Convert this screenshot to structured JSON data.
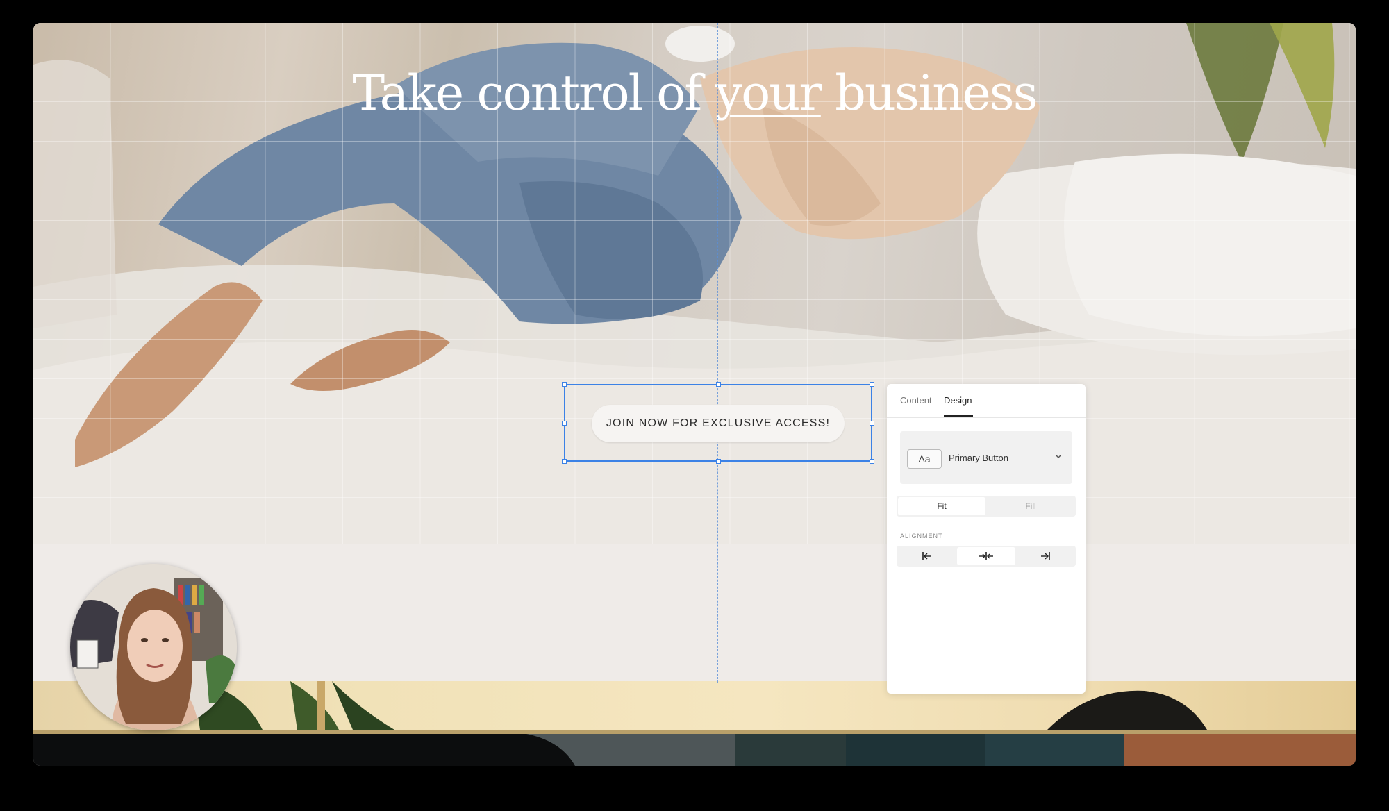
{
  "hero": {
    "title_part1": "Take control of ",
    "title_underlined": "your",
    "title_part2": " business"
  },
  "cta": {
    "label": "JOIN NOW FOR EXCLUSIVE ACCESS!"
  },
  "panel": {
    "tabs": [
      {
        "label": "Content",
        "active": false
      },
      {
        "label": "Design",
        "active": true
      }
    ],
    "style_select": {
      "chip": "Aa",
      "value": "Primary Button",
      "icon": "chevron-down-icon"
    },
    "width_options": [
      {
        "label": "Fit",
        "active": true
      },
      {
        "label": "Fill",
        "active": false
      }
    ],
    "alignment_label": "ALIGNMENT",
    "alignment_options": [
      {
        "icon": "align-left-icon",
        "active": false
      },
      {
        "icon": "align-center-icon",
        "active": true
      },
      {
        "icon": "align-right-icon",
        "active": false
      }
    ]
  },
  "colors": {
    "selection": "#3c82e6",
    "section_bg": "#efebe8",
    "button_bg": "#f6f4f2"
  }
}
